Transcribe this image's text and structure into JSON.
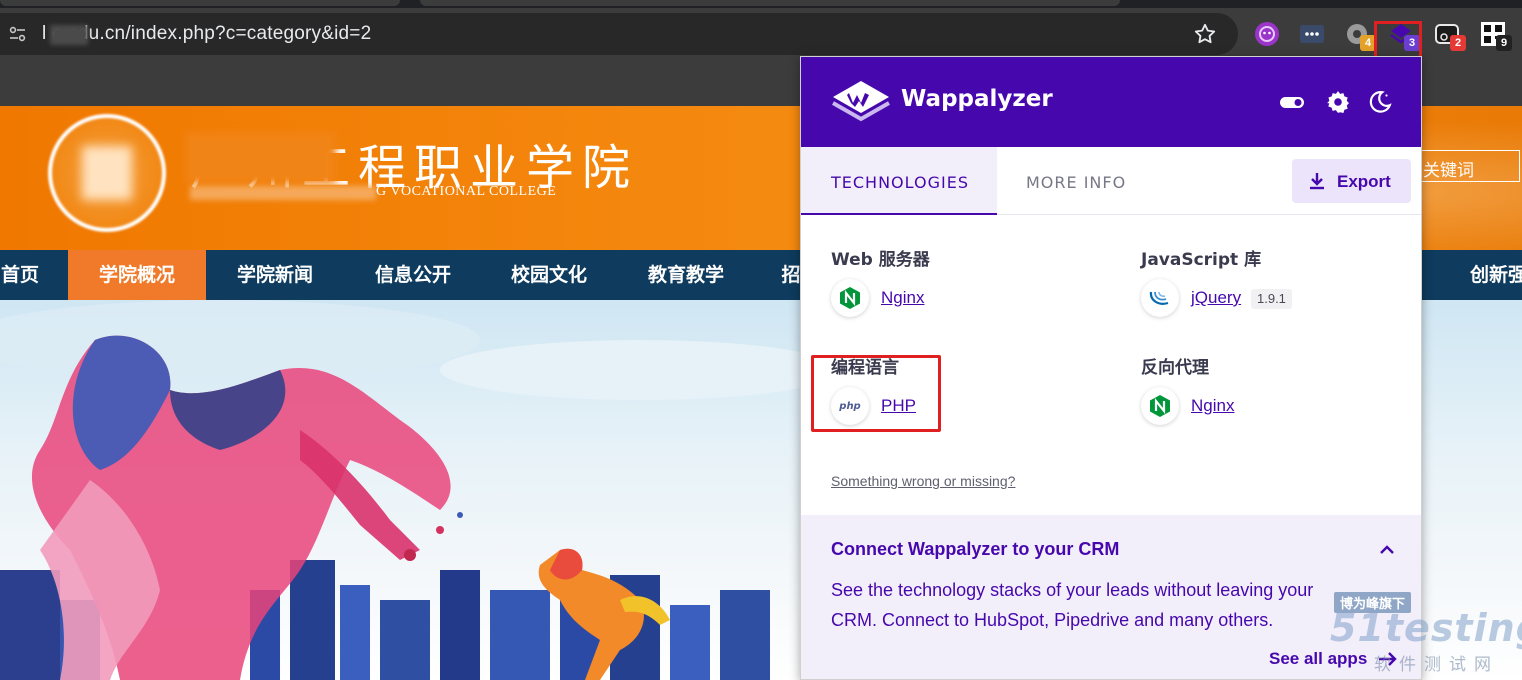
{
  "browser": {
    "url": "l     c.edu.cn/index.php?c=category&id=2",
    "extensions": [
      {
        "name": "avatar-extension",
        "badge": ""
      },
      {
        "name": "more-extension",
        "badge": ""
      },
      {
        "name": "gray-extension",
        "badge": "4",
        "badge_color": "#e5a22a"
      },
      {
        "name": "wappalyzer-extension",
        "badge": "3",
        "badge_color": "#6a3fcf"
      },
      {
        "name": "camera-extension",
        "badge": "2",
        "badge_color": "#e53935"
      },
      {
        "name": "qr-extension",
        "badge": "9",
        "badge_color": "#222222"
      }
    ]
  },
  "site": {
    "college_name": "广州工程职业学院",
    "college_en": "G VOCATIONAL COLLEGE",
    "search_placeholder": "关键词",
    "nav": [
      "首页",
      "学院概况",
      "学院新闻",
      "信息公开",
      "校园文化",
      "教育教学",
      "招",
      "创新强"
    ],
    "active_nav": "学院概况",
    "brand_orange": "#f07800",
    "nav_color": "#0e3b5e"
  },
  "wappalyzer": {
    "title": "Wappalyzer",
    "tabs": {
      "technologies": "TECHNOLOGIES",
      "more_info": "MORE INFO"
    },
    "export_label": "Export",
    "categories": [
      {
        "title": "Web 服务器",
        "tech": "Nginx",
        "icon": "nginx-icon",
        "version": ""
      },
      {
        "title": "JavaScript 库",
        "tech": "jQuery",
        "icon": "jquery-icon",
        "version": "1.9.1"
      },
      {
        "title": "编程语言",
        "tech": "PHP",
        "icon": "php-icon",
        "version": ""
      },
      {
        "title": "反向代理",
        "tech": "Nginx",
        "icon": "nginx-icon",
        "version": ""
      }
    ],
    "feedback_link": "Something wrong or missing?",
    "crm": {
      "title": "Connect Wappalyzer to your CRM",
      "text": "See the technology stacks of your leads without leaving your CRM. Connect to HubSpot, Pipedrive and many others.",
      "link": "See all apps"
    },
    "accent_color": "#4608ad"
  },
  "watermark": {
    "tag": "博为峰旗下",
    "brand": "51testing",
    "sub": "软件测试网"
  }
}
